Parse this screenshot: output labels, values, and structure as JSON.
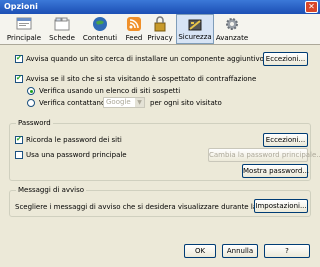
{
  "window": {
    "title": "Opzioni",
    "close_glyph": "✕"
  },
  "tabs": [
    {
      "label": "Principale",
      "icon": "main-icon"
    },
    {
      "label": "Schede",
      "icon": "tabs-icon"
    },
    {
      "label": "Contenuti",
      "icon": "content-icon"
    },
    {
      "label": "Feed",
      "icon": "feed-icon"
    },
    {
      "label": "Privacy",
      "icon": "privacy-icon"
    },
    {
      "label": "Sicurezza",
      "icon": "security-icon",
      "active": true
    },
    {
      "label": "Avanzate",
      "icon": "gear-icon"
    }
  ],
  "top": {
    "addon_warn": {
      "label": "Avvisa quando un sito cerca di installare un componente aggiuntivo",
      "checked": true
    },
    "addon_exceptions": "Eccezioni...",
    "forgery_warn": {
      "label": "Avvisa se il sito che si sta visitando è sospettato di contraffazione",
      "checked": true
    },
    "radio_list": {
      "label": "Verifica usando un elenco di siti sospetti",
      "checked": true
    },
    "radio_contact": {
      "label": "Verifica contattando",
      "checked": false
    },
    "provider_select": "Google",
    "per_site": "per ogni sito visitato"
  },
  "password": {
    "legend": "Password",
    "remember": {
      "label": "Ricorda le password dei siti",
      "checked": true
    },
    "exceptions": "Eccezioni...",
    "master": {
      "label": "Usa una password principale",
      "checked": false
    },
    "change_master": "Cambia la password principale...",
    "show": "Mostra password..."
  },
  "warnings": {
    "legend": "Messaggi di avviso",
    "text": "Scegliere i messaggi di avviso che si desidera visualizzare durante la navigazione",
    "settings": "Impostazioni..."
  },
  "footer": {
    "ok": "OK",
    "cancel": "Annulla",
    "help": "?"
  },
  "colors": {
    "accent": "#21a121",
    "titlebar": "#1c4fb4"
  }
}
